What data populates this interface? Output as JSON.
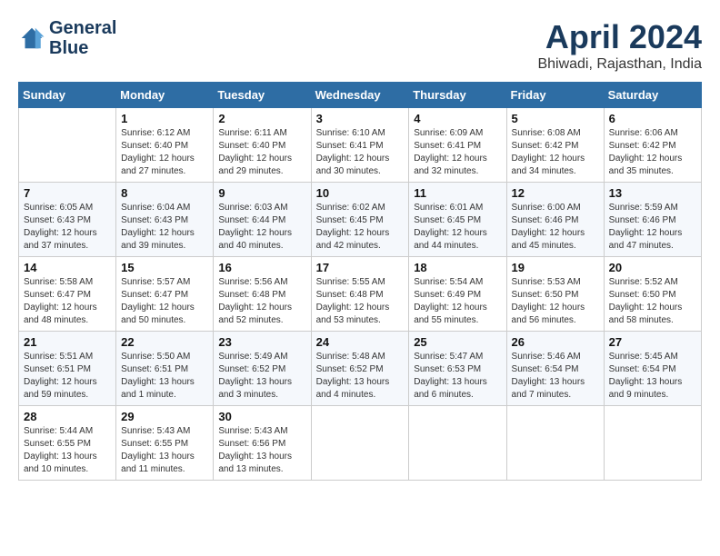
{
  "header": {
    "logo_line1": "General",
    "logo_line2": "Blue",
    "month_year": "April 2024",
    "location": "Bhiwadi, Rajasthan, India"
  },
  "weekdays": [
    "Sunday",
    "Monday",
    "Tuesday",
    "Wednesday",
    "Thursday",
    "Friday",
    "Saturday"
  ],
  "weeks": [
    [
      {
        "day": "",
        "info": ""
      },
      {
        "day": "1",
        "info": "Sunrise: 6:12 AM\nSunset: 6:40 PM\nDaylight: 12 hours\nand 27 minutes."
      },
      {
        "day": "2",
        "info": "Sunrise: 6:11 AM\nSunset: 6:40 PM\nDaylight: 12 hours\nand 29 minutes."
      },
      {
        "day": "3",
        "info": "Sunrise: 6:10 AM\nSunset: 6:41 PM\nDaylight: 12 hours\nand 30 minutes."
      },
      {
        "day": "4",
        "info": "Sunrise: 6:09 AM\nSunset: 6:41 PM\nDaylight: 12 hours\nand 32 minutes."
      },
      {
        "day": "5",
        "info": "Sunrise: 6:08 AM\nSunset: 6:42 PM\nDaylight: 12 hours\nand 34 minutes."
      },
      {
        "day": "6",
        "info": "Sunrise: 6:06 AM\nSunset: 6:42 PM\nDaylight: 12 hours\nand 35 minutes."
      }
    ],
    [
      {
        "day": "7",
        "info": "Sunrise: 6:05 AM\nSunset: 6:43 PM\nDaylight: 12 hours\nand 37 minutes."
      },
      {
        "day": "8",
        "info": "Sunrise: 6:04 AM\nSunset: 6:43 PM\nDaylight: 12 hours\nand 39 minutes."
      },
      {
        "day": "9",
        "info": "Sunrise: 6:03 AM\nSunset: 6:44 PM\nDaylight: 12 hours\nand 40 minutes."
      },
      {
        "day": "10",
        "info": "Sunrise: 6:02 AM\nSunset: 6:45 PM\nDaylight: 12 hours\nand 42 minutes."
      },
      {
        "day": "11",
        "info": "Sunrise: 6:01 AM\nSunset: 6:45 PM\nDaylight: 12 hours\nand 44 minutes."
      },
      {
        "day": "12",
        "info": "Sunrise: 6:00 AM\nSunset: 6:46 PM\nDaylight: 12 hours\nand 45 minutes."
      },
      {
        "day": "13",
        "info": "Sunrise: 5:59 AM\nSunset: 6:46 PM\nDaylight: 12 hours\nand 47 minutes."
      }
    ],
    [
      {
        "day": "14",
        "info": "Sunrise: 5:58 AM\nSunset: 6:47 PM\nDaylight: 12 hours\nand 48 minutes."
      },
      {
        "day": "15",
        "info": "Sunrise: 5:57 AM\nSunset: 6:47 PM\nDaylight: 12 hours\nand 50 minutes."
      },
      {
        "day": "16",
        "info": "Sunrise: 5:56 AM\nSunset: 6:48 PM\nDaylight: 12 hours\nand 52 minutes."
      },
      {
        "day": "17",
        "info": "Sunrise: 5:55 AM\nSunset: 6:48 PM\nDaylight: 12 hours\nand 53 minutes."
      },
      {
        "day": "18",
        "info": "Sunrise: 5:54 AM\nSunset: 6:49 PM\nDaylight: 12 hours\nand 55 minutes."
      },
      {
        "day": "19",
        "info": "Sunrise: 5:53 AM\nSunset: 6:50 PM\nDaylight: 12 hours\nand 56 minutes."
      },
      {
        "day": "20",
        "info": "Sunrise: 5:52 AM\nSunset: 6:50 PM\nDaylight: 12 hours\nand 58 minutes."
      }
    ],
    [
      {
        "day": "21",
        "info": "Sunrise: 5:51 AM\nSunset: 6:51 PM\nDaylight: 12 hours\nand 59 minutes."
      },
      {
        "day": "22",
        "info": "Sunrise: 5:50 AM\nSunset: 6:51 PM\nDaylight: 13 hours\nand 1 minute."
      },
      {
        "day": "23",
        "info": "Sunrise: 5:49 AM\nSunset: 6:52 PM\nDaylight: 13 hours\nand 3 minutes."
      },
      {
        "day": "24",
        "info": "Sunrise: 5:48 AM\nSunset: 6:52 PM\nDaylight: 13 hours\nand 4 minutes."
      },
      {
        "day": "25",
        "info": "Sunrise: 5:47 AM\nSunset: 6:53 PM\nDaylight: 13 hours\nand 6 minutes."
      },
      {
        "day": "26",
        "info": "Sunrise: 5:46 AM\nSunset: 6:54 PM\nDaylight: 13 hours\nand 7 minutes."
      },
      {
        "day": "27",
        "info": "Sunrise: 5:45 AM\nSunset: 6:54 PM\nDaylight: 13 hours\nand 9 minutes."
      }
    ],
    [
      {
        "day": "28",
        "info": "Sunrise: 5:44 AM\nSunset: 6:55 PM\nDaylight: 13 hours\nand 10 minutes."
      },
      {
        "day": "29",
        "info": "Sunrise: 5:43 AM\nSunset: 6:55 PM\nDaylight: 13 hours\nand 11 minutes."
      },
      {
        "day": "30",
        "info": "Sunrise: 5:43 AM\nSunset: 6:56 PM\nDaylight: 13 hours\nand 13 minutes."
      },
      {
        "day": "",
        "info": ""
      },
      {
        "day": "",
        "info": ""
      },
      {
        "day": "",
        "info": ""
      },
      {
        "day": "",
        "info": ""
      }
    ]
  ]
}
